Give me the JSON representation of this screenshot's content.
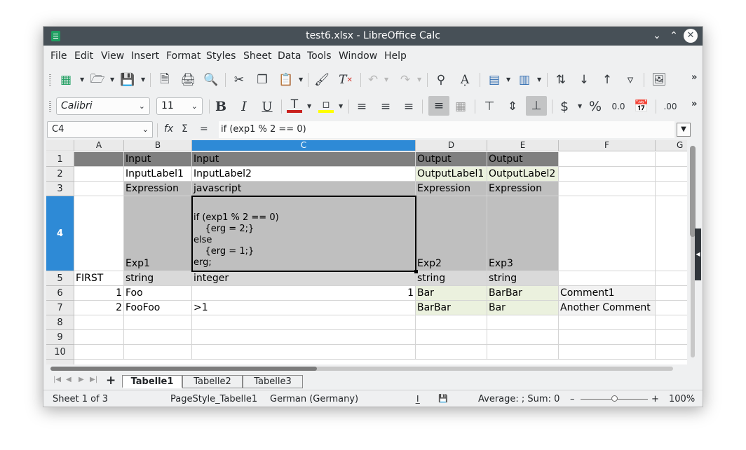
{
  "window": {
    "title": "test6.xlsx - LibreOffice Calc"
  },
  "menu": [
    "File",
    "Edit",
    "View",
    "Insert",
    "Format",
    "Styles",
    "Sheet",
    "Data",
    "Tools",
    "Window",
    "Help"
  ],
  "format_toolbar": {
    "font_name": "Calibri",
    "font_size": "11"
  },
  "formula_bar": {
    "name_box": "C4",
    "formula": "if (exp1 % 2 == 0)",
    "fx": "fx",
    "sum": "Σ",
    "equals": "="
  },
  "columns": [
    "A",
    "B",
    "C",
    "D",
    "E",
    "F",
    "G"
  ],
  "selected_column": "C",
  "rows": [
    "1",
    "2",
    "3",
    "4",
    "5",
    "6",
    "7",
    "8",
    "9",
    "10"
  ],
  "selected_row": "4",
  "cells": {
    "B1": "Input",
    "C1": "Input",
    "D1": "Output",
    "E1": "Output",
    "B2": "InputLabel1",
    "C2": "InputLabel2",
    "D2": "OutputLabel1",
    "E2": "OutputLabel2",
    "B3": "Expression",
    "C3": "javascript",
    "D3": "Expression",
    "E3": "Expression",
    "B4": "Exp1",
    "C4": "if (exp1 % 2 == 0)\n    {erg = 2;}\nelse\n    {erg = 1;}\nerg;",
    "D4": "Exp2",
    "E4": "Exp3",
    "A5": "FIRST",
    "B5": "string",
    "C5": "integer",
    "D5": "string",
    "E5": "string",
    "A6": "1",
    "B6": "Foo",
    "C6": "1",
    "D6": "Bar",
    "E6": "BarBar",
    "F6": "Comment1",
    "A7": "2",
    "B7": "FooFoo",
    "C7": ">1",
    "D7": "BarBar",
    "E7": "Bar",
    "F7": "Another Comment"
  },
  "sheets": [
    "Tabelle1",
    "Tabelle2",
    "Tabelle3"
  ],
  "active_sheet": "Tabelle1",
  "status": {
    "sheet": "Sheet 1 of 3",
    "page_style": "PageStyle_Tabelle1",
    "language": "German (Germany)",
    "summary": "Average: ; Sum: 0",
    "zoom_minus": "–",
    "zoom_plus": "+",
    "zoom": "100%"
  }
}
